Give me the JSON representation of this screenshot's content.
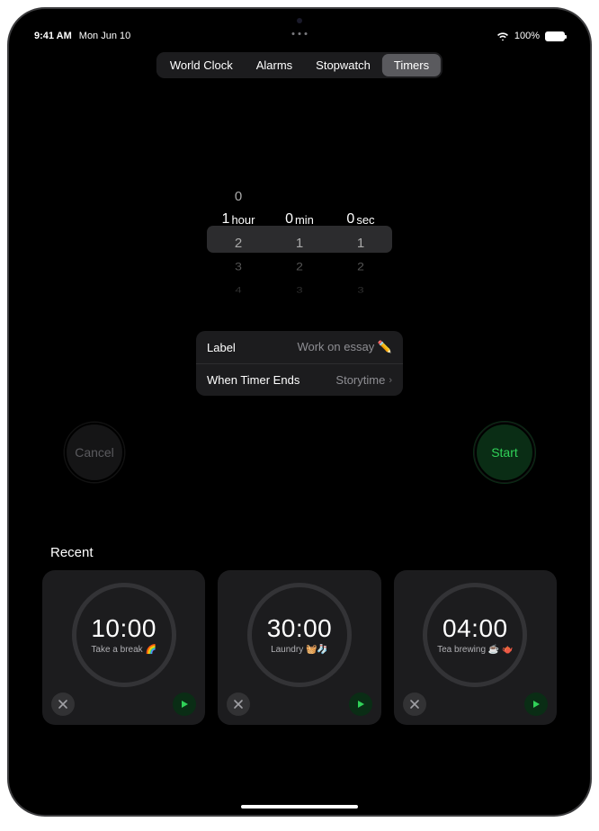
{
  "status": {
    "time": "9:41 AM",
    "date": "Mon Jun 10",
    "battery_pct": "100%"
  },
  "tabs": {
    "world_clock": "World Clock",
    "alarms": "Alarms",
    "stopwatch": "Stopwatch",
    "timers": "Timers",
    "active": "timers"
  },
  "picker": {
    "hours": {
      "selected": "1",
      "unit": "hour",
      "above": [
        "0"
      ],
      "below": [
        "2",
        "3",
        "4"
      ]
    },
    "minutes": {
      "selected": "0",
      "unit": "min",
      "above": [],
      "below": [
        "1",
        "2",
        "3"
      ]
    },
    "seconds": {
      "selected": "0",
      "unit": "sec",
      "above": [],
      "below": [
        "1",
        "2",
        "3"
      ]
    }
  },
  "settings": {
    "label_title": "Label",
    "label_value": "Work on essay ✏️",
    "ends_title": "When Timer Ends",
    "ends_value": "Storytime"
  },
  "buttons": {
    "cancel": "Cancel",
    "start": "Start"
  },
  "recent": {
    "title": "Recent",
    "items": [
      {
        "time": "10:00",
        "label": "Take a break 🌈"
      },
      {
        "time": "30:00",
        "label": "Laundry 🧺🧦"
      },
      {
        "time": "04:00",
        "label": "Tea brewing ☕️ 🫖"
      }
    ]
  }
}
